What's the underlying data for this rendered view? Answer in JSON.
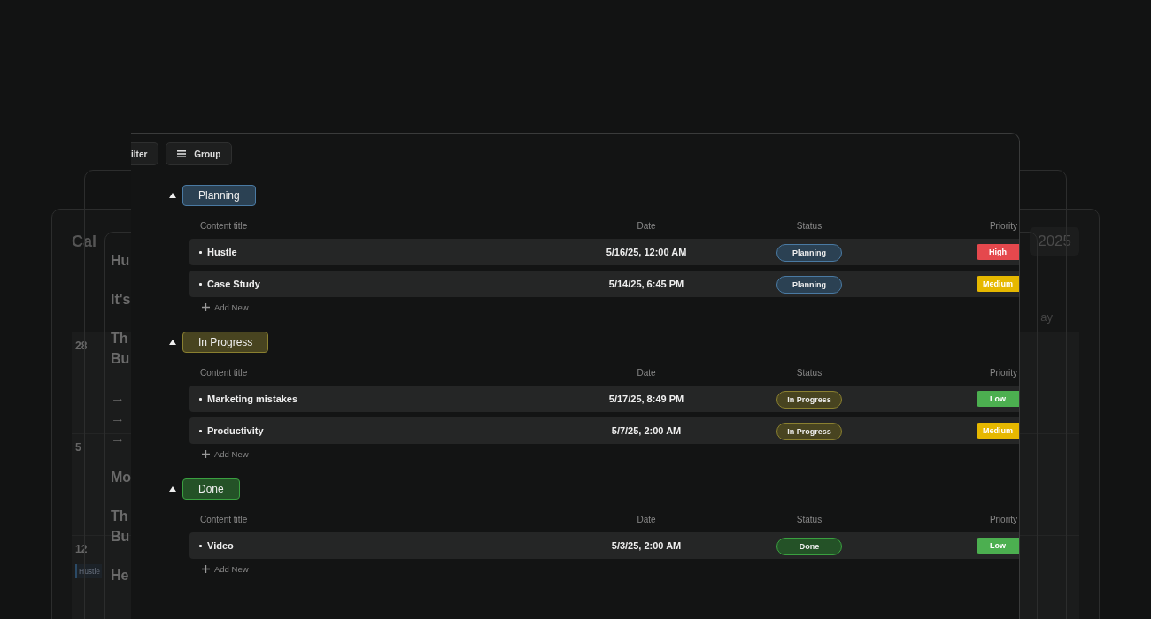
{
  "background_windows": {
    "calendar": {
      "title": "Cal",
      "year": "2025",
      "weekday": "ay",
      "weeks": [
        {
          "day": "28"
        },
        {
          "day": "5"
        },
        {
          "day": "12",
          "event": "Hustle"
        }
      ]
    },
    "card": {
      "paragraphs": [
        [
          "Hu"
        ],
        [
          "It's"
        ],
        [
          "Th",
          "Bu"
        ],
        [
          "→",
          "→",
          "→"
        ],
        [
          "Mo"
        ],
        [
          "Th",
          "Bu"
        ],
        [
          "He"
        ]
      ]
    }
  },
  "toolbar": {
    "buttons": [
      {
        "label": "ilter",
        "kind": "plain"
      },
      {
        "label": "Group",
        "kind": "list"
      }
    ]
  },
  "groups": [
    {
      "name": "Planning",
      "color": "#4a7aa3",
      "expanded": true,
      "columns": [
        "Content title",
        "Date",
        "Status",
        "Priority"
      ],
      "rows": [
        {
          "title": "Hustle",
          "date": "5/16/25, 12:00 AM",
          "status": "Planning",
          "priority": {
            "label": "High",
            "color": "#e5484d"
          }
        },
        {
          "title": "Case Study",
          "date": "5/14/25, 6:45 PM",
          "status": "Planning",
          "priority": {
            "label": "Medium",
            "color": "#e6b800"
          }
        }
      ],
      "add_label": "Add New"
    },
    {
      "name": "In Progress",
      "color": "#8a8030",
      "expanded": true,
      "columns": [
        "Content title",
        "Date",
        "Status",
        "Priority"
      ],
      "rows": [
        {
          "title": "Marketing mistakes",
          "date": "5/17/25, 8:49 PM",
          "status": "In Progress",
          "priority": {
            "label": "Low",
            "color": "#4caf50"
          }
        },
        {
          "title": "Productivity",
          "date": "5/7/25, 2:00 AM",
          "status": "In Progress",
          "priority": {
            "label": "Medium",
            "color": "#e6b800"
          }
        }
      ],
      "add_label": "Add New"
    },
    {
      "name": "Done",
      "color": "#3aa040",
      "expanded": true,
      "columns": [
        "Content title",
        "Date",
        "Status",
        "Priority"
      ],
      "rows": [
        {
          "title": "Video",
          "date": "5/3/25, 2:00 AM",
          "status": "Done",
          "priority": {
            "label": "Low",
            "color": "#4caf50"
          }
        }
      ],
      "add_label": "Add New"
    }
  ]
}
